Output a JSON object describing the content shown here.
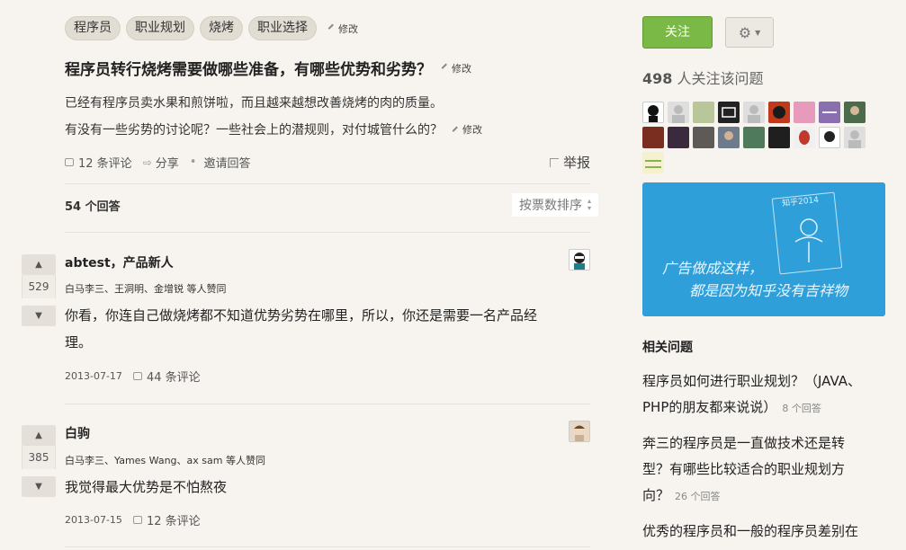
{
  "question": {
    "tags": [
      "程序员",
      "职业规划",
      "烧烤",
      "职业选择"
    ],
    "edit_label": "修改",
    "title": "程序员转行烧烤需要做哪些准备，有哪些优势和劣势？",
    "detail_lines": [
      "已经有程序员卖水果和煎饼啦，而且越来越想改善烧烤的肉的质量。",
      "有没有一些劣势的讨论呢？一些社会上的潜规则，对付城管什么的？"
    ],
    "comments": "12 条评论",
    "share": "分享",
    "invite": "邀请回答",
    "report": "举报"
  },
  "answers_header": {
    "count": "54 个回答",
    "sort": "按票数排序"
  },
  "answers": [
    {
      "votes": "529",
      "author": "abtest，产品新人",
      "voters": "白马李三、王洞明、金增锐 等人赞同",
      "content_lines": [
        "你看，你连自己做烧烤都不知道优势劣势在哪里，所以，你还是需要一名产品经",
        "理。"
      ],
      "date": "2013-07-17",
      "comments": "44 条评论"
    },
    {
      "votes": "385",
      "author": "白驹",
      "voters": "白马李三、Yames Wang、ax sam 等人赞同",
      "content_lines": [
        "我觉得最大优势是不怕熬夜"
      ],
      "date": "2013-07-15",
      "comments": "12 条评论"
    }
  ],
  "sidebar": {
    "follow": "关注",
    "follower_count": "498",
    "follower_text": "人关注该问题",
    "ad": {
      "card_text": "知乎2014",
      "line1": "广告做成这样，",
      "line2": "都是因为知乎没有吉祥物"
    },
    "related_title": "相关问题",
    "related": [
      {
        "lines": [
          "程序员如何进行职业规划？（JAVA、",
          "PHP的朋友都来说说）"
        ],
        "count": "8 个回答"
      },
      {
        "lines": [
          "奔三的程序员是一直做技术还是转",
          "型？有哪些比较适合的职业规划方",
          "向？"
        ],
        "count": "26 个回答"
      },
      {
        "lines": [
          "优秀的程序员和一般的程序员差别在"
        ],
        "count": ""
      }
    ]
  },
  "colors": {
    "accent": "#7ab946",
    "ad_bg": "#2e9fd8",
    "page_bg": "#f7f4ef"
  }
}
